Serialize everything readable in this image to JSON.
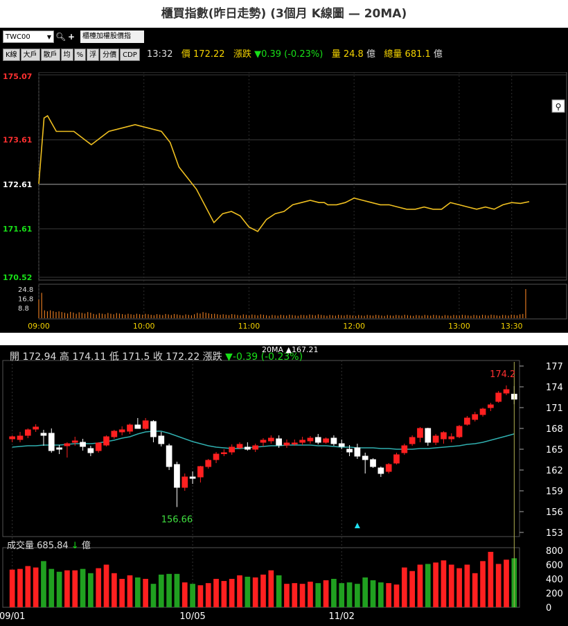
{
  "title": "櫃買指數(昨日走勢) (3個月 K線圖  — 20MA)",
  "intraday": {
    "ticker": "TWC00",
    "index_name": "櫃檯加權股價指",
    "buttons": [
      "K線",
      "大戶",
      "散戶",
      "均",
      "%",
      "浮",
      "分價",
      "CDP"
    ],
    "quote": {
      "time": "13:32",
      "price_label": "價",
      "price": "172.22",
      "change_label": "漲跌",
      "change": "▼0.39 (-0.23%)",
      "vol_label": "量",
      "vol": "24.8",
      "vol_unit": "億",
      "total_label": "總量",
      "total": "681.1",
      "total_unit": "億"
    },
    "link_icon": "link-icon",
    "price_axis": [
      "175.07",
      "173.61",
      "172.61",
      "171.61",
      "170.52"
    ],
    "vol_axis": [
      "24.8",
      "16.8",
      "8.8"
    ],
    "time_axis": [
      "09:00",
      "10:00",
      "11:00",
      "12:00",
      "13:00",
      "13:30"
    ]
  },
  "kline": {
    "ohlc": {
      "open_label": "開",
      "open": "172.94",
      "high_label": "高",
      "high": "174.11",
      "low_label": "低",
      "low": "171.5",
      "close_label": "收",
      "close": "172.22",
      "change_label": "漲跌",
      "change": "▼-0.39 (-0.23%)"
    },
    "ma_text": "20MA ▲167.21",
    "high_mark": "174.2",
    "low_mark": "156.66",
    "vol_label": "成交量",
    "vol_value": "685.84",
    "vol_arrow": "↓",
    "vol_unit": "億",
    "price_ticks": [
      "177",
      "174",
      "171",
      "168",
      "165",
      "162",
      "159",
      "156",
      "153"
    ],
    "vol_ticks": [
      "800",
      "600",
      "400",
      "200",
      "0"
    ],
    "date_ticks": [
      "09/01",
      "10/05",
      "11/02"
    ]
  },
  "chart_data": [
    {
      "type": "line",
      "xlabel": "",
      "ylabel": "",
      "ylim": [
        170.52,
        175.07
      ],
      "x_ticks": [
        "09:00",
        "10:00",
        "11:00",
        "12:00",
        "13:00",
        "13:30"
      ],
      "reference": 172.61,
      "x": [
        0,
        3,
        5,
        10,
        20,
        30,
        40,
        50,
        55,
        60,
        70,
        75,
        80,
        90,
        100,
        105,
        110,
        115,
        120,
        125,
        130,
        135,
        140,
        145,
        150,
        155,
        160,
        163,
        165,
        170,
        175,
        180,
        185,
        190,
        195,
        200,
        205,
        210,
        215,
        220,
        225,
        230,
        235,
        240,
        245,
        250,
        255,
        260,
        265,
        270,
        275,
        280
      ],
      "values": [
        172.62,
        174.1,
        174.15,
        173.8,
        173.8,
        173.5,
        173.8,
        173.9,
        173.95,
        173.9,
        173.8,
        173.55,
        173.0,
        172.5,
        171.75,
        171.95,
        172.0,
        171.9,
        171.65,
        171.55,
        171.82,
        171.95,
        172.0,
        172.15,
        172.2,
        172.25,
        172.2,
        172.2,
        172.15,
        172.15,
        172.2,
        172.3,
        172.25,
        172.2,
        172.15,
        172.15,
        172.1,
        172.05,
        172.05,
        172.1,
        172.05,
        172.05,
        172.2,
        172.15,
        172.1,
        172.05,
        172.1,
        172.05,
        172.15,
        172.2,
        172.18,
        172.22
      ],
      "volume": [
        20,
        7,
        6,
        5,
        4.5,
        4,
        3.8,
        3.5,
        3.4,
        3.2,
        3.2,
        3.1,
        3.0,
        4.5,
        3.5,
        3.0,
        3.0,
        3.0,
        2.8,
        2.8,
        2.6,
        2.6,
        2.6,
        2.6,
        2.8,
        2.8,
        2.7,
        2.6,
        2.6,
        2.6,
        2.5,
        2.5,
        2.5,
        2.5,
        2.5,
        2.5,
        2.5,
        2.5,
        2.5,
        2.5,
        2.5,
        2.5,
        2.5,
        2.5,
        2.6,
        2.6,
        2.6,
        2.6,
        2.7,
        2.8,
        3.5,
        24.8
      ]
    },
    {
      "type": "bar",
      "xlabel": "",
      "ylabel": "",
      "ylim": [
        153,
        177
      ],
      "vol_ylim": [
        0,
        800
      ],
      "x_ticks": [
        "09/01",
        "10/05",
        "11/02"
      ],
      "candles": [
        [
          166.5,
          167.0,
          166.0,
          166.8
        ],
        [
          166.4,
          167.5,
          166.0,
          166.9
        ],
        [
          167.0,
          168.0,
          166.6,
          167.8
        ],
        [
          167.9,
          168.6,
          167.5,
          168.2
        ],
        [
          167.3,
          167.8,
          165.5,
          167.0
        ],
        [
          167.3,
          168.0,
          164.5,
          164.8
        ],
        [
          165.2,
          165.6,
          164.3,
          165.0
        ],
        [
          165.5,
          166.0,
          163.8,
          165.8
        ],
        [
          166.0,
          166.8,
          165.5,
          166.2
        ],
        [
          166.0,
          166.5,
          164.8,
          165.4
        ],
        [
          165.1,
          165.5,
          164.0,
          164.5
        ],
        [
          164.8,
          166.0,
          164.5,
          165.9
        ],
        [
          165.6,
          167.0,
          165.4,
          166.8
        ],
        [
          166.8,
          167.8,
          166.5,
          167.6
        ],
        [
          167.5,
          168.3,
          167.0,
          167.8
        ],
        [
          167.6,
          168.7,
          167.2,
          168.5
        ],
        [
          168.5,
          169.5,
          168.0,
          168.0
        ],
        [
          168.0,
          169.5,
          167.8,
          169.1
        ],
        [
          169.0,
          169.2,
          166.0,
          166.8
        ],
        [
          166.9,
          167.5,
          165.4,
          165.8
        ],
        [
          165.5,
          165.8,
          162.0,
          162.5
        ],
        [
          162.8,
          163.2,
          156.66,
          159.5
        ],
        [
          159.5,
          161.5,
          159.0,
          161.0
        ],
        [
          161.0,
          161.8,
          160.0,
          160.8
        ],
        [
          161.0,
          162.6,
          160.2,
          162.5
        ],
        [
          162.5,
          163.6,
          162.2,
          163.4
        ],
        [
          163.5,
          164.6,
          163.0,
          164.3
        ],
        [
          164.5,
          165.0,
          164.0,
          164.5
        ],
        [
          164.6,
          165.7,
          164.2,
          165.3
        ],
        [
          165.2,
          166.0,
          165.0,
          165.7
        ],
        [
          165.3,
          166.0,
          164.8,
          165.0
        ],
        [
          165.0,
          165.8,
          164.6,
          165.5
        ],
        [
          166.0,
          166.6,
          165.4,
          166.3
        ],
        [
          166.2,
          167.0,
          165.8,
          166.6
        ],
        [
          166.5,
          167.0,
          165.2,
          165.6
        ],
        [
          165.6,
          166.4,
          165.2,
          165.9
        ],
        [
          165.8,
          166.4,
          165.5,
          165.9
        ],
        [
          166.0,
          166.8,
          165.6,
          166.3
        ],
        [
          166.2,
          166.9,
          165.8,
          166.6
        ],
        [
          166.7,
          167.2,
          165.7,
          166.0
        ],
        [
          166.0,
          166.7,
          165.8,
          166.5
        ],
        [
          166.6,
          167.0,
          165.5,
          165.8
        ],
        [
          165.8,
          166.4,
          165.0,
          165.4
        ],
        [
          165.0,
          165.6,
          164.0,
          164.6
        ],
        [
          165.2,
          165.8,
          163.6,
          164.0
        ],
        [
          164.0,
          164.5,
          161.5,
          163.5
        ],
        [
          163.5,
          163.7,
          162.3,
          162.5
        ],
        [
          162.3,
          162.5,
          161.0,
          161.5
        ],
        [
          161.8,
          163.0,
          161.5,
          162.8
        ],
        [
          163.0,
          164.5,
          162.8,
          164.2
        ],
        [
          164.5,
          165.8,
          164.2,
          165.5
        ],
        [
          165.8,
          167.0,
          165.5,
          166.7
        ],
        [
          166.7,
          168.2,
          166.0,
          168.0
        ],
        [
          168.0,
          168.1,
          165.5,
          166.0
        ],
        [
          166.0,
          167.2,
          165.6,
          166.9
        ],
        [
          166.5,
          167.6,
          165.8,
          167.4
        ],
        [
          166.5,
          167.3,
          166.0,
          166.8
        ],
        [
          166.8,
          168.5,
          166.6,
          168.3
        ],
        [
          168.6,
          169.8,
          168.4,
          169.5
        ],
        [
          169.3,
          170.4,
          169.0,
          170.0
        ],
        [
          170.0,
          171.0,
          169.7,
          170.8
        ],
        [
          171.0,
          171.7,
          170.5,
          171.4
        ],
        [
          171.9,
          173.4,
          171.7,
          173.1
        ],
        [
          173.1,
          174.2,
          172.8,
          173.6
        ],
        [
          172.94,
          174.11,
          171.5,
          172.22
        ]
      ],
      "ma20": [
        165.3,
        165.4,
        165.5,
        165.5,
        165.6,
        165.6,
        165.6,
        165.7,
        165.8,
        165.8,
        165.8,
        165.9,
        166.1,
        166.3,
        166.6,
        166.8,
        167.2,
        167.5,
        167.6,
        167.6,
        167.3,
        166.9,
        166.5,
        166.1,
        165.8,
        165.5,
        165.3,
        165.2,
        165.1,
        165.1,
        165.2,
        165.3,
        165.4,
        165.5,
        165.5,
        165.6,
        165.6,
        165.6,
        165.6,
        165.5,
        165.5,
        165.4,
        165.3,
        165.3,
        165.2,
        165.2,
        165.2,
        165.1,
        165.1,
        165.0,
        165.0,
        165.0,
        165.1,
        165.1,
        165.2,
        165.3,
        165.4,
        165.5,
        165.7,
        165.8,
        166.0,
        166.3,
        166.6,
        166.9,
        167.21
      ],
      "volume": [
        530,
        540,
        580,
        560,
        650,
        540,
        500,
        520,
        520,
        540,
        480,
        550,
        600,
        480,
        400,
        450,
        420,
        400,
        330,
        460,
        470,
        470,
        350,
        330,
        310,
        340,
        400,
        370,
        400,
        450,
        430,
        420,
        460,
        520,
        450,
        330,
        340,
        330,
        360,
        340,
        380,
        400,
        340,
        350,
        330,
        420,
        380,
        350,
        340,
        320,
        560,
        510,
        600,
        610,
        630,
        660,
        600,
        550,
        600,
        480,
        650,
        780,
        610,
        670,
        690
      ]
    }
  ]
}
